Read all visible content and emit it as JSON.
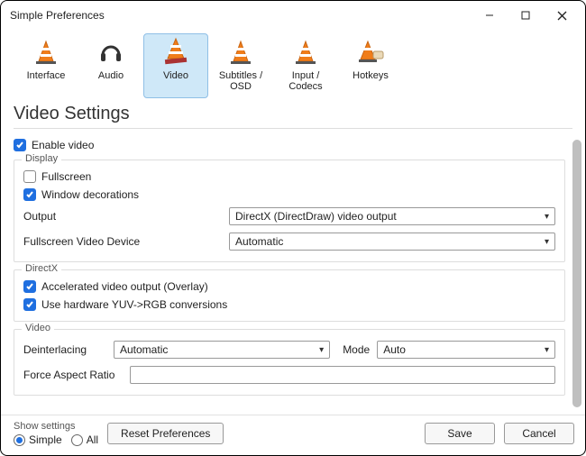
{
  "window": {
    "title": "Simple Preferences"
  },
  "tabs": [
    {
      "label": "Interface"
    },
    {
      "label": "Audio"
    },
    {
      "label": "Video"
    },
    {
      "label": "Subtitles / OSD"
    },
    {
      "label": "Input / Codecs"
    },
    {
      "label": "Hotkeys"
    }
  ],
  "heading": "Video Settings",
  "enable_video": {
    "label": "Enable video",
    "checked": true
  },
  "display": {
    "legend": "Display",
    "fullscreen": {
      "label": "Fullscreen",
      "checked": false
    },
    "window_decorations": {
      "label": "Window decorations",
      "checked": true
    },
    "output_label": "Output",
    "output_value": "DirectX (DirectDraw) video output",
    "fs_device_label": "Fullscreen Video Device",
    "fs_device_value": "Automatic"
  },
  "directx": {
    "legend": "DirectX",
    "accel": {
      "label": "Accelerated video output (Overlay)",
      "checked": true
    },
    "yuvrgb": {
      "label": "Use hardware YUV->RGB conversions",
      "checked": true
    }
  },
  "video": {
    "legend": "Video",
    "deint_label": "Deinterlacing",
    "deint_value": "Automatic",
    "mode_label": "Mode",
    "mode_value": "Auto",
    "far_label": "Force Aspect Ratio",
    "far_value": ""
  },
  "show_settings": {
    "legend": "Show settings",
    "simple": "Simple",
    "all": "All",
    "selected": "simple"
  },
  "buttons": {
    "reset": "Reset Preferences",
    "save": "Save",
    "cancel": "Cancel"
  }
}
